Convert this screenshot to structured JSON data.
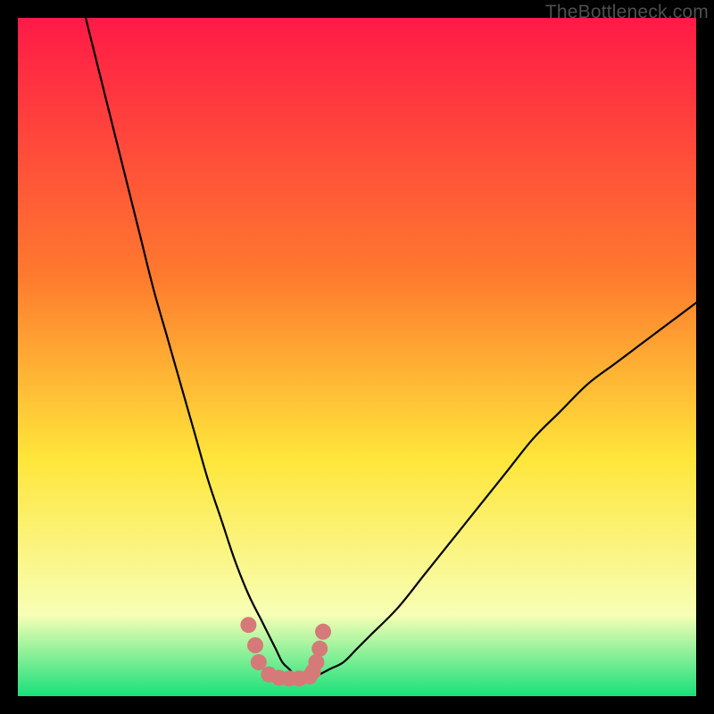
{
  "watermark": {
    "label": "TheBottleneck.com"
  },
  "colors": {
    "bg": "#000000",
    "grad_top": "#ff1a47",
    "grad_mid1": "#ff7a2e",
    "grad_mid2": "#ffe63a",
    "grad_low": "#f7ffb5",
    "grad_bottom": "#18e07a",
    "curve": "#000000",
    "markers": "#d57a78"
  },
  "chart_data": {
    "type": "line",
    "title": "",
    "xlabel": "",
    "ylabel": "",
    "xlim": [
      0,
      100
    ],
    "ylim": [
      0,
      100
    ],
    "grid": false,
    "legend": false,
    "annotations": [
      "TheBottleneck.com"
    ],
    "series": [
      {
        "name": "bottleneck-curve",
        "x": [
          10,
          12,
          14,
          16,
          18,
          20,
          22,
          24,
          26,
          28,
          30,
          32,
          34,
          36,
          37,
          38,
          39,
          40,
          41,
          42,
          43,
          44,
          46,
          48,
          50,
          52,
          56,
          60,
          64,
          68,
          72,
          76,
          80,
          84,
          88,
          92,
          96,
          100
        ],
        "values": [
          100,
          92,
          84,
          76,
          68,
          60,
          53,
          46,
          39,
          32,
          26,
          20,
          15,
          11,
          9,
          7,
          5,
          4,
          3,
          3,
          3,
          3,
          4,
          5,
          7,
          9,
          13,
          18,
          23,
          28,
          33,
          38,
          42,
          46,
          49,
          52,
          55,
          58
        ]
      }
    ],
    "markers": {
      "name": "highlight-dots",
      "x": [
        34.0,
        35.0,
        35.5,
        37.0,
        38.5,
        40.0,
        41.5,
        43.0,
        43.5,
        44.0,
        44.5,
        45.0
      ],
      "values": [
        10.5,
        7.5,
        5.0,
        3.2,
        2.7,
        2.6,
        2.6,
        2.9,
        3.6,
        5.0,
        7.0,
        9.5
      ]
    }
  }
}
